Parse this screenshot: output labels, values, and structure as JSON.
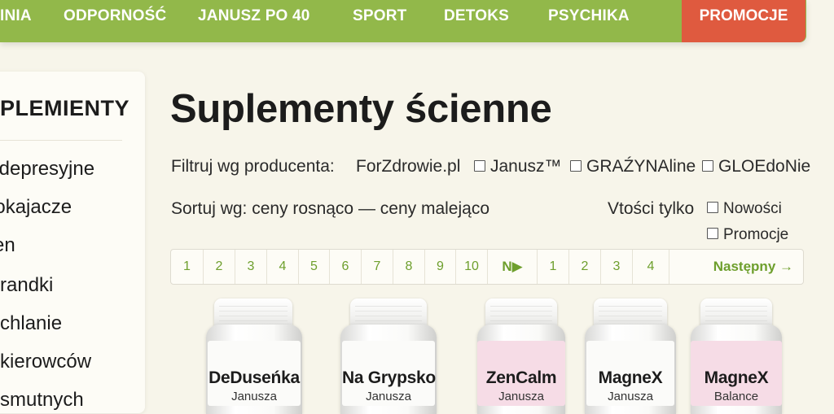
{
  "nav": {
    "items": [
      "INIA",
      "ODPORNOŚĆ",
      "JANUSZ PO 40",
      "SPORT",
      "DETOKS",
      "PSYCHIKA"
    ],
    "promo": "PROMOCJE"
  },
  "sidebar": {
    "title": "PLEMIENTY",
    "items": [
      "tydepresyjne",
      "pokajacze",
      " sen",
      "n randki",
      "o chlanie",
      "a kierowców",
      "a smutnych"
    ]
  },
  "main": {
    "title": "Suplementy ścienne",
    "filter": {
      "label": "Filtruj wg producenta:",
      "first": "ForZdrowie.pl",
      "options": [
        "Janusz™",
        "GRAŹYNAline",
        "GLOEdoNie"
      ]
    },
    "sort": {
      "text": "Sortuj wg: ceny rosnąco — ceny malejąco",
      "only_label": "Vtości tylko",
      "options": [
        "Nowości",
        "Promocje"
      ]
    },
    "pagination": {
      "pages_a": [
        "1",
        "2",
        "3",
        "4",
        "5",
        "6",
        "7",
        "8",
        "9",
        "10"
      ],
      "n_label": "N▶",
      "pages_b": [
        "1",
        "2",
        "3",
        "4"
      ],
      "next_label": "Następny →"
    }
  },
  "products": [
    {
      "name": "DeDuseńka",
      "sub": "Janusza",
      "label_color": "white"
    },
    {
      "name": "Na Grypsko",
      "sub": "Janusza",
      "label_color": "white"
    },
    {
      "name": "ZenCalm",
      "sub": "Janusza",
      "label_color": "pink"
    },
    {
      "name": "MagneX",
      "sub": "Janusza",
      "label_color": "white"
    },
    {
      "name": "MagneX",
      "sub": "Balance",
      "label_color": "pink"
    }
  ],
  "colors": {
    "nav_green": "#92b84a",
    "promo_red": "#df5a3f",
    "page_bg": "#f7f5ea",
    "link_green": "#6e9f2d"
  }
}
